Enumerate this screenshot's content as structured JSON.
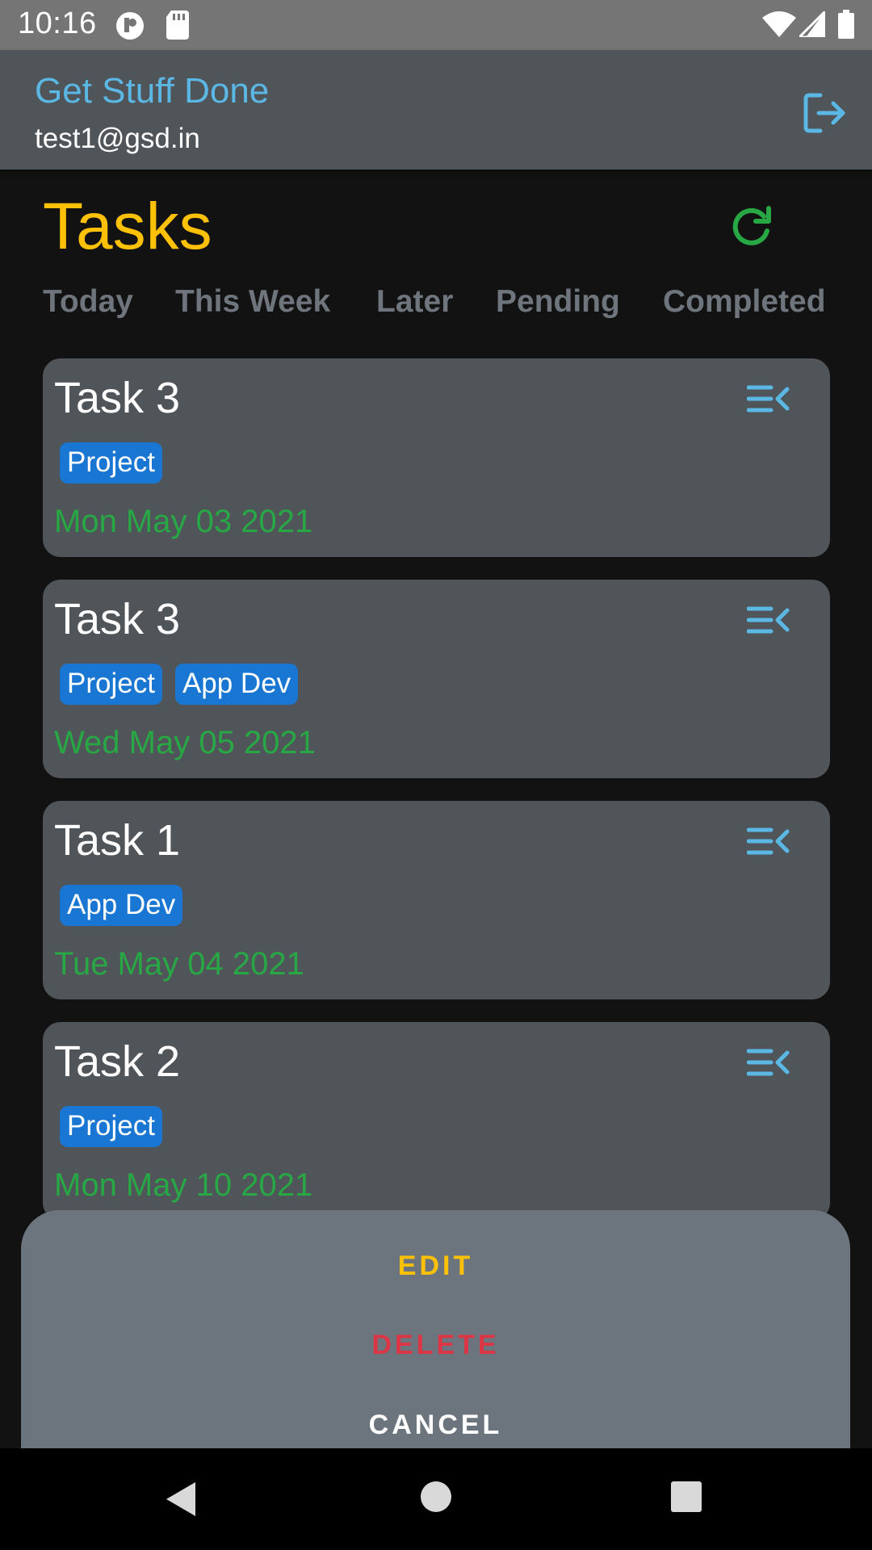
{
  "status_bar": {
    "time": "10:16",
    "left_icons": [
      "notification-icon",
      "sd-card-icon"
    ],
    "right_icons": [
      "wifi-icon",
      "signal-icon",
      "battery-icon"
    ]
  },
  "app_bar": {
    "title": "Get Stuff Done",
    "email": "test1@gsd.in",
    "logout_icon": "logout-icon",
    "colors": {
      "title": "#5bb8e4",
      "background": "#50555a"
    }
  },
  "header": {
    "title": "Tasks",
    "refresh_icon": "refresh-icon",
    "colors": {
      "title": "#ffc107",
      "refresh": "#28a745"
    }
  },
  "tabs": [
    {
      "label": "Today"
    },
    {
      "label": "This Week"
    },
    {
      "label": "Later"
    },
    {
      "label": "Pending"
    },
    {
      "label": "Completed"
    }
  ],
  "tasks": [
    {
      "title": "Task 3",
      "tags": [
        "Project"
      ],
      "date": "Mon May 03 2021"
    },
    {
      "title": "Task 3",
      "tags": [
        "Project",
        "App Dev"
      ],
      "date": "Wed May 05 2021"
    },
    {
      "title": "Task 1",
      "tags": [
        "App Dev"
      ],
      "date": "Tue May 04 2021"
    },
    {
      "title": "Task 2",
      "tags": [
        "Project"
      ],
      "date": "Mon May 10 2021"
    }
  ],
  "action_sheet": {
    "edit_label": "EDIT",
    "delete_label": "DELETE",
    "cancel_label": "CANCEL",
    "colors": {
      "edit": "#ffc107",
      "delete": "#dc3545",
      "cancel": "#ffffff",
      "background": "#6c757d"
    }
  },
  "nav_bar": {
    "icons": [
      "back-icon",
      "home-icon",
      "recents-icon"
    ]
  }
}
